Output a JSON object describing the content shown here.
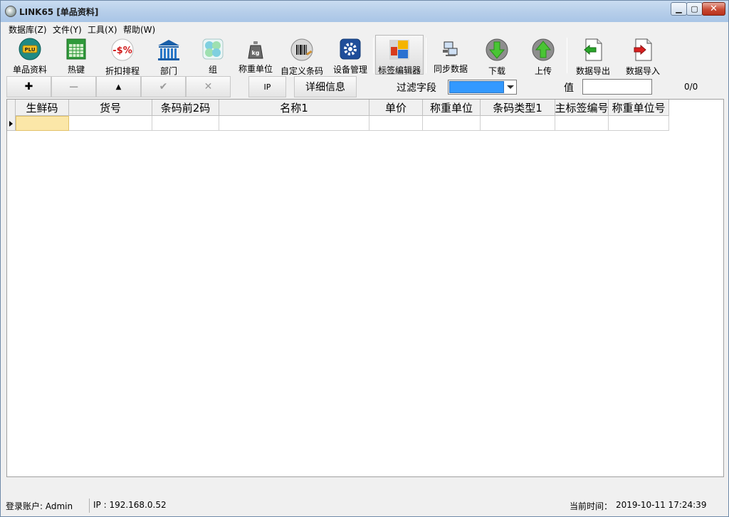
{
  "window": {
    "title": "LINK65 [单品资料]"
  },
  "menu": [
    {
      "label": "数据库(Z)"
    },
    {
      "label": "文件(Y)"
    },
    {
      "label": "工具(X)"
    },
    {
      "label": "帮助(W)"
    }
  ],
  "toolbar": [
    {
      "label": "单品资料",
      "icon": "plu-icon"
    },
    {
      "label": "热键",
      "icon": "hotkey-grid-icon"
    },
    {
      "label": "折扣排程",
      "icon": "discount-icon"
    },
    {
      "label": "部门",
      "icon": "department-icon"
    },
    {
      "label": "组",
      "icon": "group-icon"
    },
    {
      "label": "称重单位",
      "icon": "weight-icon"
    },
    {
      "label": "自定义条码",
      "icon": "barcode-icon"
    },
    {
      "label": "设备管理",
      "icon": "device-settings-icon"
    },
    {
      "label": "标签编辑器",
      "icon": "label-editor-icon"
    },
    {
      "label": "同步数据",
      "icon": "sync-icon"
    },
    {
      "label": "下载",
      "icon": "download-icon"
    },
    {
      "label": "上传",
      "icon": "upload-icon"
    },
    {
      "label": "数据导出",
      "icon": "export-icon"
    },
    {
      "label": "数据导入",
      "icon": "import-icon"
    }
  ],
  "navbar": {
    "add": "✚",
    "remove": "−",
    "up": "▲",
    "confirm": "✔",
    "cancel": "✕",
    "ip_label": "IP",
    "detail_label": "详细信息",
    "filter_label": "过滤字段",
    "value_label": "值",
    "value": "",
    "record_count": "0/0"
  },
  "grid": {
    "columns": [
      "生鲜码",
      "货号",
      "条码前2码",
      "名称1",
      "单价",
      "称重单位",
      "条码类型1",
      "主标签编号",
      "称重单位号"
    ],
    "rows": [
      [
        "",
        "",
        "",
        "",
        "",
        "",
        "",
        "",
        ""
      ]
    ]
  },
  "status": {
    "account": "登录账户: Admin",
    "ip": "IP : 192.168.0.52",
    "time_label": "当前时间：",
    "time": "2019-10-11 17:24:39"
  },
  "colors": {
    "titlebar": "#b7cfea",
    "close_button": "#c94a33",
    "selected_cell": "#fbe7a8",
    "filter_highlight": "#3399ff"
  }
}
